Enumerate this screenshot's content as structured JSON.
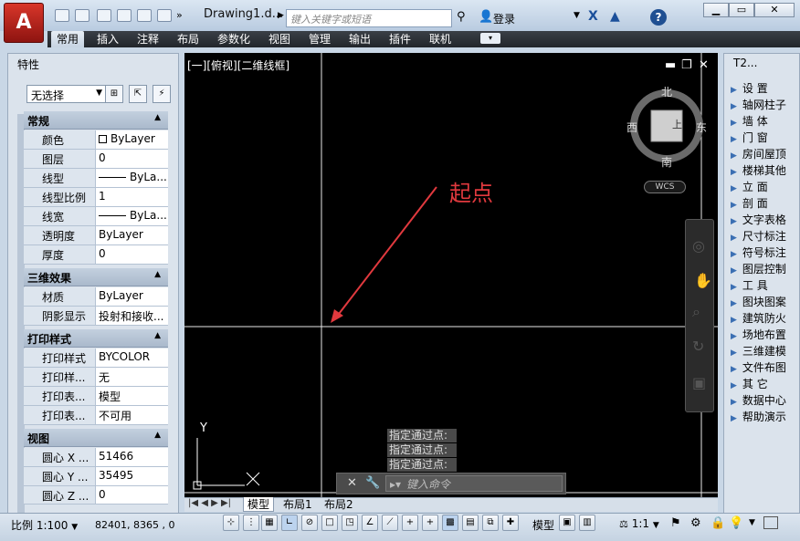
{
  "app": {
    "doc_title": "Drawing1.d...",
    "search_placeholder": "键入关键字或短语",
    "login_label": "登录",
    "help_label": "?"
  },
  "menu": {
    "tabs": [
      "常用",
      "插入",
      "注释",
      "布局",
      "参数化",
      "视图",
      "管理",
      "输出",
      "插件",
      "联机"
    ]
  },
  "properties": {
    "title": "特性",
    "selection": "无选择",
    "sections": [
      {
        "title": "常规",
        "rows": [
          {
            "k": "颜色",
            "v": "ByLayer"
          },
          {
            "k": "图层",
            "v": "0"
          },
          {
            "k": "线型",
            "v": "ByLa..."
          },
          {
            "k": "线型比例",
            "v": "1"
          },
          {
            "k": "线宽",
            "v": "ByLa..."
          },
          {
            "k": "透明度",
            "v": "ByLayer"
          },
          {
            "k": "厚度",
            "v": "0"
          }
        ]
      },
      {
        "title": "三维效果",
        "rows": [
          {
            "k": "材质",
            "v": "ByLayer"
          },
          {
            "k": "阴影显示",
            "v": "投射和接收..."
          }
        ]
      },
      {
        "title": "打印样式",
        "rows": [
          {
            "k": "打印样式",
            "v": "BYCOLOR"
          },
          {
            "k": "打印样...",
            "v": "无"
          },
          {
            "k": "打印表...",
            "v": "模型"
          },
          {
            "k": "打印表...",
            "v": "不可用"
          }
        ]
      },
      {
        "title": "视图",
        "rows": [
          {
            "k": "圆心 X ...",
            "v": "51466"
          },
          {
            "k": "圆心 Y ...",
            "v": "35495"
          },
          {
            "k": "圆心 Z ...",
            "v": "0"
          }
        ]
      }
    ]
  },
  "viewport": {
    "label": "[一][俯视][二维线框]",
    "annotation": "起点",
    "compass": {
      "north": "北",
      "south": "南",
      "east": "东",
      "west": "西"
    },
    "wcs": "WCS",
    "axis_y": "Y",
    "command_history": [
      "指定通过点:",
      "指定通过点:",
      "指定通过点:"
    ],
    "command_placeholder": "键入命令"
  },
  "layout_tabs": [
    "模型",
    "布局1",
    "布局2"
  ],
  "tool_palette": {
    "title": "T2...",
    "items": [
      "设  置",
      "轴网柱子",
      "墙  体",
      "门  窗",
      "房间屋顶",
      "楼梯其他",
      "立  面",
      "剖  面",
      "文字表格",
      "尺寸标注",
      "符号标注",
      "图层控制",
      "工  具",
      "图块图案",
      "建筑防火",
      "场地布置",
      "三维建模",
      "文件布图",
      "其  它",
      "数据中心",
      "帮助演示"
    ]
  },
  "status": {
    "scale": "比例 1:100",
    "coords": "82401, 8365 , 0",
    "model": "模型",
    "anno_scale": "1:1"
  },
  "colors": {
    "canvas": "#000000",
    "annotation_red": "#e0393e",
    "crosshair": "#ffffff"
  }
}
